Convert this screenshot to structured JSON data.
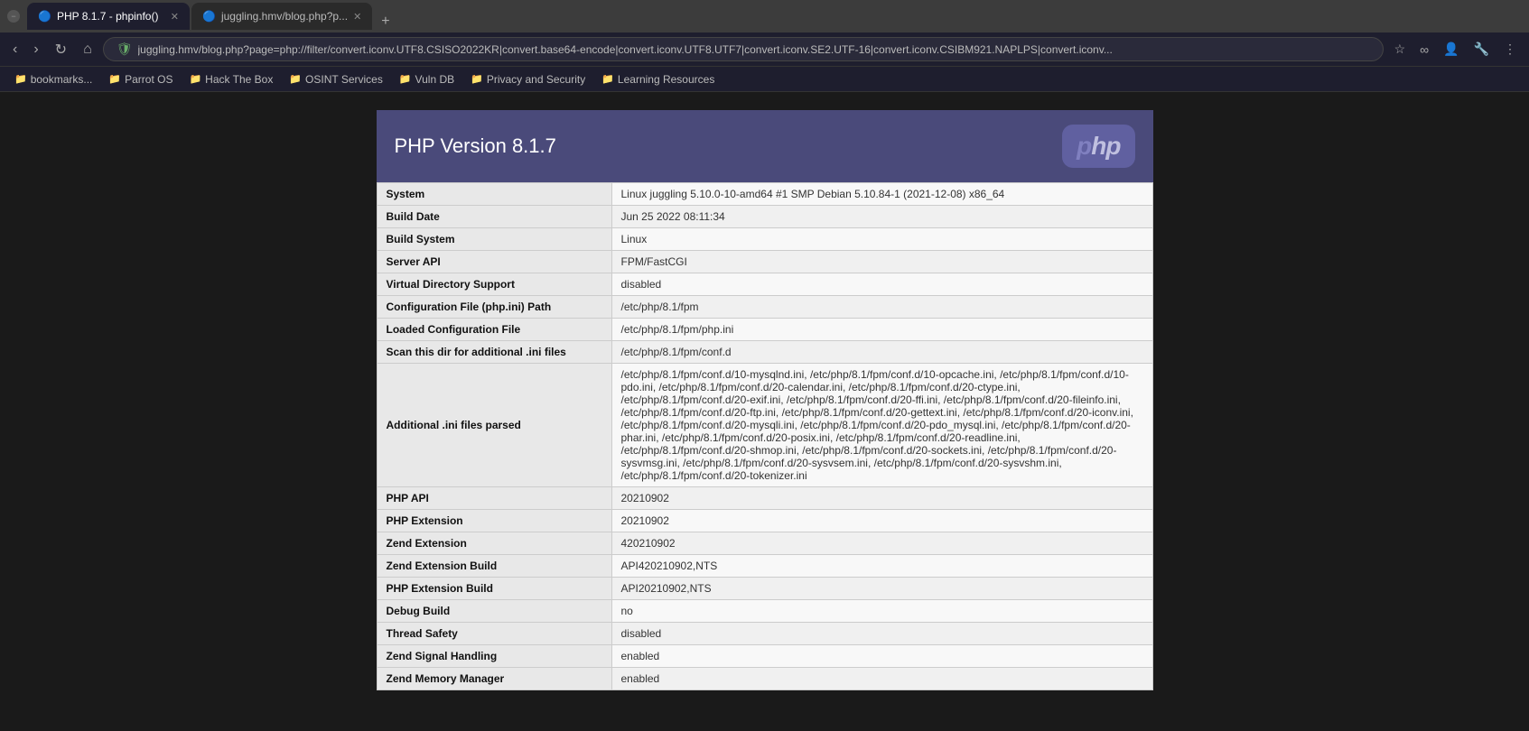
{
  "browser": {
    "tabs": [
      {
        "id": "tab1",
        "title": "PHP 8.1.7 - phpinfo()",
        "active": true,
        "closable": true
      },
      {
        "id": "tab2",
        "title": "juggling.hmv/blog.php?p...",
        "active": false,
        "closable": true
      }
    ],
    "new_tab_label": "+",
    "url": "juggling.hmv/blog.php?page=php://filter/convert.iconv.UTF8.CSISO2022KR|convert.base64-encode|convert.iconv.UTF8.UTF7|convert.iconv.SE2.UTF-16|convert.iconv.CSIBM921.NAPLPS|convert.iconv...",
    "nav_buttons": {
      "back": "‹",
      "forward": "›",
      "reload": "↻",
      "home": "⌂"
    }
  },
  "bookmarks": [
    {
      "label": "bookmarks...",
      "icon": "📁"
    },
    {
      "label": "Parrot OS",
      "icon": "📁"
    },
    {
      "label": "Hack The Box",
      "icon": "📁"
    },
    {
      "label": "OSINT Services",
      "icon": "📁"
    },
    {
      "label": "Vuln DB",
      "icon": "📁"
    },
    {
      "label": "Privacy and Security",
      "icon": "📁"
    },
    {
      "label": "Learning Resources",
      "icon": "📁"
    }
  ],
  "phpinfo": {
    "version_label": "PHP Version 8.1.7",
    "logo_text": "php",
    "rows": [
      {
        "key": "System",
        "value": "Linux juggling 5.10.0-10-amd64 #1 SMP Debian 5.10.84-1 (2021-12-08) x86_64"
      },
      {
        "key": "Build Date",
        "value": "Jun 25 2022 08:11:34"
      },
      {
        "key": "Build System",
        "value": "Linux"
      },
      {
        "key": "Server API",
        "value": "FPM/FastCGI"
      },
      {
        "key": "Virtual Directory Support",
        "value": "disabled"
      },
      {
        "key": "Configuration File (php.ini) Path",
        "value": "/etc/php/8.1/fpm"
      },
      {
        "key": "Loaded Configuration File",
        "value": "/etc/php/8.1/fpm/php.ini"
      },
      {
        "key": "Scan this dir for additional .ini files",
        "value": "/etc/php/8.1/fpm/conf.d"
      },
      {
        "key": "Additional .ini files parsed",
        "value": "/etc/php/8.1/fpm/conf.d/10-mysqlnd.ini, /etc/php/8.1/fpm/conf.d/10-opcache.ini, /etc/php/8.1/fpm/conf.d/10-pdo.ini, /etc/php/8.1/fpm/conf.d/20-calendar.ini, /etc/php/8.1/fpm/conf.d/20-ctype.ini, /etc/php/8.1/fpm/conf.d/20-exif.ini, /etc/php/8.1/fpm/conf.d/20-ffi.ini, /etc/php/8.1/fpm/conf.d/20-fileinfo.ini, /etc/php/8.1/fpm/conf.d/20-ftp.ini, /etc/php/8.1/fpm/conf.d/20-gettext.ini, /etc/php/8.1/fpm/conf.d/20-iconv.ini, /etc/php/8.1/fpm/conf.d/20-mysqli.ini, /etc/php/8.1/fpm/conf.d/20-pdo_mysql.ini, /etc/php/8.1/fpm/conf.d/20-phar.ini, /etc/php/8.1/fpm/conf.d/20-posix.ini, /etc/php/8.1/fpm/conf.d/20-readline.ini, /etc/php/8.1/fpm/conf.d/20-shmop.ini, /etc/php/8.1/fpm/conf.d/20-sockets.ini, /etc/php/8.1/fpm/conf.d/20-sysvmsg.ini, /etc/php/8.1/fpm/conf.d/20-sysvsem.ini, /etc/php/8.1/fpm/conf.d/20-sysvshm.ini, /etc/php/8.1/fpm/conf.d/20-tokenizer.ini"
      },
      {
        "key": "PHP API",
        "value": "20210902"
      },
      {
        "key": "PHP Extension",
        "value": "20210902"
      },
      {
        "key": "Zend Extension",
        "value": "420210902"
      },
      {
        "key": "Zend Extension Build",
        "value": "API420210902,NTS"
      },
      {
        "key": "PHP Extension Build",
        "value": "API20210902,NTS"
      },
      {
        "key": "Debug Build",
        "value": "no"
      },
      {
        "key": "Thread Safety",
        "value": "disabled"
      },
      {
        "key": "Zend Signal Handling",
        "value": "enabled"
      },
      {
        "key": "Zend Memory Manager",
        "value": "enabled"
      }
    ]
  }
}
